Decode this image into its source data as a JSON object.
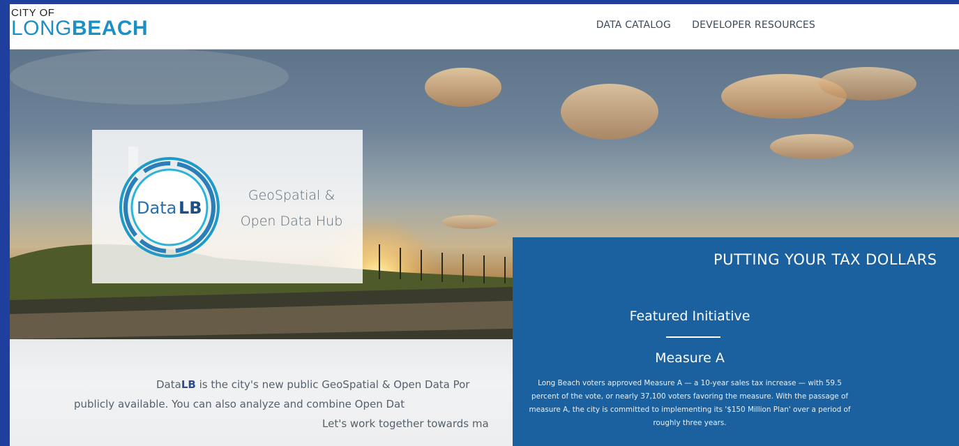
{
  "header": {
    "logo_city": "CITY OF",
    "logo_long": "LONG",
    "logo_beach": "BEACH",
    "nav": [
      {
        "label": "DATA CATALOG"
      },
      {
        "label": "DEVELOPER RESOURCES"
      }
    ]
  },
  "hero_card": {
    "badge_text_data": "Data",
    "badge_text_lb": "LB",
    "title_line1": "GeoSpatial &",
    "title_line2": "Open Data Hub"
  },
  "intro": {
    "line1_prefix": "Data",
    "line1_bold": "LB",
    "line1_rest": " is the city's new public GeoSpatial & Open Data Por",
    "line2": "publicly available. You can also analyze and combine Open Dat",
    "line3": "Let's work together towards ma"
  },
  "panel": {
    "heading": "PUTTING YOUR TAX DOLLARS",
    "featured": "Featured Initiative",
    "title": "Measure A",
    "desc_lines": [
      "Long Beach voters approved Measure A — a 10-year sales tax increase — with 59.5",
      "percent of the vote, or nearly 37,100 voters favoring the measure. With the passage of",
      "measure A, the city is committed to implementing its '$150 Million Plan' over a period of",
      "roughly three years."
    ]
  },
  "colors": {
    "frame_bg": "#1f3f9e",
    "brand_blue": "#1c8fc4",
    "panel_blue": "#1b61a0"
  }
}
